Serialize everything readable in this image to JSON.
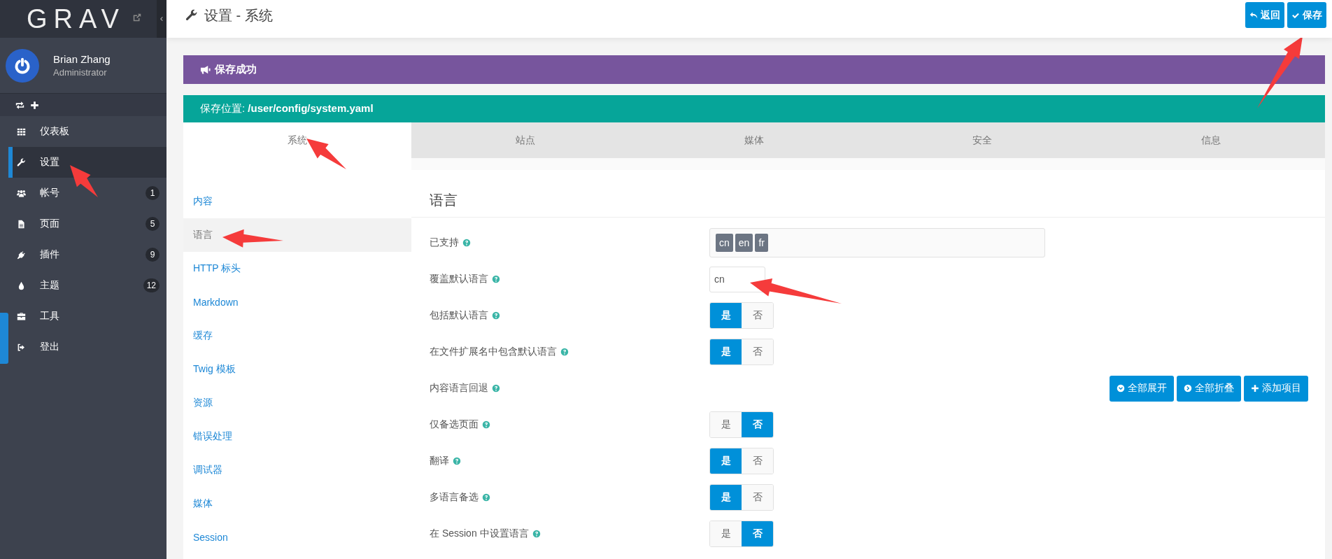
{
  "sidebar": {
    "logo": "GRAV",
    "user": {
      "name": "Brian Zhang",
      "role": "Administrator"
    },
    "items": [
      {
        "label": "仪表板",
        "selected": false
      },
      {
        "label": "设置",
        "selected": true
      },
      {
        "label": "帐号",
        "selected": false,
        "count": "1"
      },
      {
        "label": "页面",
        "selected": false,
        "count": "5"
      },
      {
        "label": "插件",
        "selected": false,
        "count": "9"
      },
      {
        "label": "主题",
        "selected": false,
        "count": "12"
      },
      {
        "label": "工具",
        "selected": false
      },
      {
        "label": "登出",
        "selected": false
      }
    ]
  },
  "header": {
    "title": "设置 - 系统",
    "buttons": [
      {
        "label": "返回"
      },
      {
        "label": "保存"
      }
    ]
  },
  "alerts": [
    {
      "kind": "notice",
      "text": "保存成功"
    },
    {
      "kind": "info",
      "text": "保存位置: **/user/config/system.yaml**"
    }
  ],
  "tabs": [
    {
      "label": "系统",
      "selected": true
    },
    {
      "label": "站点",
      "selected": false
    },
    {
      "label": "媒体",
      "selected": false
    },
    {
      "label": "安全",
      "selected": false
    },
    {
      "label": "信息",
      "selected": false
    }
  ],
  "subnav": [
    {
      "label": "内容",
      "selected": false
    },
    {
      "label": "语言",
      "selected": true
    },
    {
      "label": "HTTP 标头",
      "selected": false
    },
    {
      "label": "Markdown",
      "selected": false
    },
    {
      "label": "缓存",
      "selected": false
    },
    {
      "label": "Twig 模板",
      "selected": false
    },
    {
      "label": "资源",
      "selected": false
    },
    {
      "label": "错误处理",
      "selected": false
    },
    {
      "label": "调试器",
      "selected": false
    },
    {
      "label": "媒体",
      "selected": false
    },
    {
      "label": "Session",
      "selected": false
    }
  ],
  "section": {
    "title": "语言",
    "fields": [
      {
        "kind": "tags",
        "label": "已支持",
        "tags": [
          "cn",
          "en",
          "fr"
        ]
      },
      {
        "kind": "text",
        "label": "覆盖默认语言",
        "value": "cn"
      },
      {
        "kind": "toggle",
        "label": "包括默认语言",
        "options": [
          {
            "label": "是",
            "selected": true
          },
          {
            "label": "否",
            "selected": false
          }
        ]
      },
      {
        "kind": "toggle",
        "label": "在文件扩展名中包含默认语言",
        "options": [
          {
            "label": "是",
            "selected": true
          },
          {
            "label": "否",
            "selected": false
          }
        ]
      },
      {
        "kind": "list",
        "label": "内容语言回退",
        "buttons": [
          {
            "label": "全部展开"
          },
          {
            "label": "全部折叠"
          },
          {
            "label": "添加项目"
          }
        ]
      },
      {
        "kind": "toggle",
        "label": "仅备选页面",
        "options": [
          {
            "label": "是",
            "selected": false
          },
          {
            "label": "否",
            "selected": true
          }
        ]
      },
      {
        "kind": "toggle",
        "label": "翻译",
        "options": [
          {
            "label": "是",
            "selected": true
          },
          {
            "label": "否",
            "selected": false
          }
        ]
      },
      {
        "kind": "toggle",
        "label": "多语言备选",
        "options": [
          {
            "label": "是",
            "selected": true
          },
          {
            "label": "否",
            "selected": false
          }
        ]
      },
      {
        "kind": "toggle",
        "label": "在 Session 中设置语言",
        "options": [
          {
            "label": "是",
            "selected": false
          },
          {
            "label": "否",
            "selected": true
          }
        ]
      }
    ]
  }
}
